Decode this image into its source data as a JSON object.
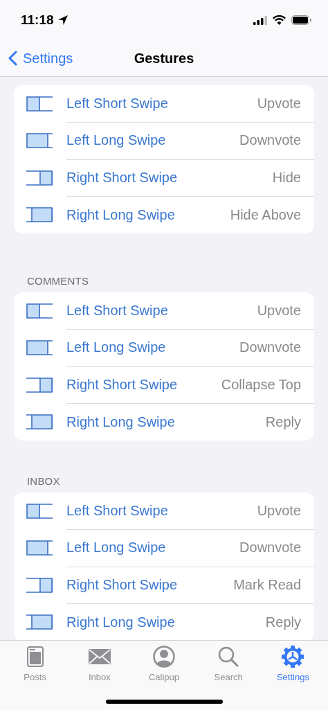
{
  "status_bar": {
    "time": "11:18"
  },
  "nav": {
    "back": "Settings",
    "title": "Gestures"
  },
  "sections": [
    {
      "rows": [
        {
          "kind": "left-short",
          "label": "Left Short Swipe",
          "value": "Upvote"
        },
        {
          "kind": "left-long",
          "label": "Left Long Swipe",
          "value": "Downvote"
        },
        {
          "kind": "right-short",
          "label": "Right Short Swipe",
          "value": "Hide"
        },
        {
          "kind": "right-long",
          "label": "Right Long Swipe",
          "value": "Hide Above"
        }
      ]
    },
    {
      "header": "COMMENTS",
      "rows": [
        {
          "kind": "left-short",
          "label": "Left Short Swipe",
          "value": "Upvote"
        },
        {
          "kind": "left-long",
          "label": "Left Long Swipe",
          "value": "Downvote"
        },
        {
          "kind": "right-short",
          "label": "Right Short Swipe",
          "value": "Collapse Top"
        },
        {
          "kind": "right-long",
          "label": "Right Long Swipe",
          "value": "Reply"
        }
      ]
    },
    {
      "header": "INBOX",
      "rows": [
        {
          "kind": "left-short",
          "label": "Left Short Swipe",
          "value": "Upvote"
        },
        {
          "kind": "left-long",
          "label": "Left Long Swipe",
          "value": "Downvote"
        },
        {
          "kind": "right-short",
          "label": "Right Short Swipe",
          "value": "Mark Read"
        },
        {
          "kind": "right-long",
          "label": "Right Long Swipe",
          "value": "Reply"
        }
      ]
    }
  ],
  "tabs": [
    {
      "kind": "posts",
      "label": "Posts",
      "selected": false
    },
    {
      "kind": "inbox",
      "label": "Inbox",
      "selected": false
    },
    {
      "kind": "profile",
      "label": "Calipup",
      "selected": false
    },
    {
      "kind": "search",
      "label": "Search",
      "selected": false
    },
    {
      "kind": "settings",
      "label": "Settings",
      "selected": true
    }
  ]
}
